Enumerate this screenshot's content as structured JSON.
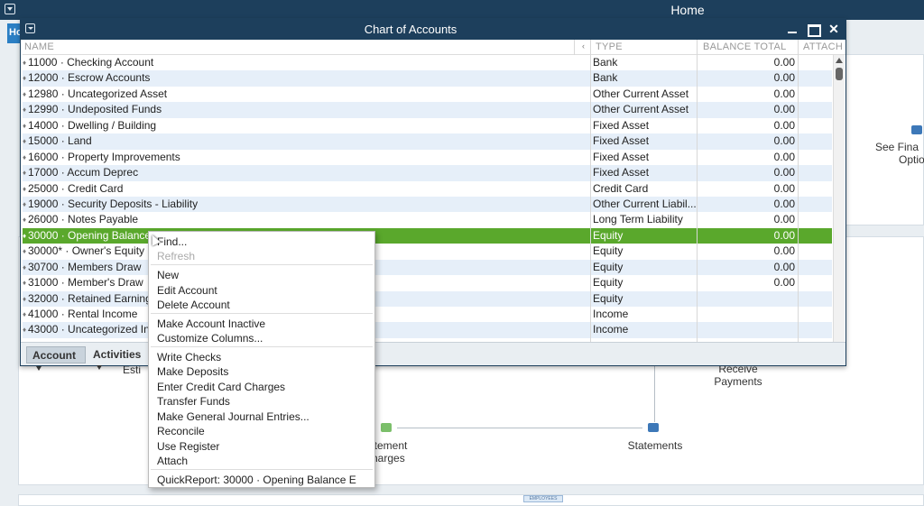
{
  "app": {
    "title": "Home",
    "tab_label": "Ho"
  },
  "background": {
    "see_financing_line1": "See Fina",
    "see_financing_line2": "Optio",
    "receive_payments_line1": "Receive",
    "receive_payments_line2": "Payments",
    "statement_charges_line1": "atement",
    "statement_charges_line2": "harges",
    "statements": "Statements",
    "estimates": "Esti",
    "employees_badge": "EMPLOYEES"
  },
  "window": {
    "title": "Chart of Accounts",
    "columns": {
      "name": "NAME",
      "type": "TYPE",
      "balance": "BALANCE TOTAL",
      "attach": "ATTACH",
      "sort_marker": "‹"
    },
    "rows": [
      {
        "name": "11000 · Checking Account",
        "type": "Bank",
        "balance": "0.00"
      },
      {
        "name": "12000 · Escrow Accounts",
        "type": "Bank",
        "balance": "0.00"
      },
      {
        "name": "12980 · Uncategorized Asset",
        "type": "Other Current Asset",
        "balance": "0.00"
      },
      {
        "name": "12990 · Undeposited Funds",
        "type": "Other Current Asset",
        "balance": "0.00"
      },
      {
        "name": "14000 · Dwelling / Building",
        "type": "Fixed Asset",
        "balance": "0.00"
      },
      {
        "name": "15000 · Land",
        "type": "Fixed Asset",
        "balance": "0.00"
      },
      {
        "name": "16000 · Property Improvements",
        "type": "Fixed Asset",
        "balance": "0.00"
      },
      {
        "name": "17000 · Accum Deprec",
        "type": "Fixed Asset",
        "balance": "0.00"
      },
      {
        "name": "25000 · Credit Card",
        "type": "Credit Card",
        "balance": "0.00"
      },
      {
        "name": "19000 · Security Deposits - Liability",
        "type": "Other Current Liabil...",
        "balance": "0.00"
      },
      {
        "name": "26000 · Notes Payable",
        "type": "Long Term Liability",
        "balance": "0.00"
      },
      {
        "name": "30000 · Opening Balance",
        "type": "Equity",
        "balance": "0.00"
      },
      {
        "name": "30000* · Owner's Equity",
        "type": "Equity",
        "balance": "0.00"
      },
      {
        "name": "30700 · Members Draw",
        "type": "Equity",
        "balance": "0.00"
      },
      {
        "name": "31000 · Member's Draw",
        "type": "Equity",
        "balance": "0.00"
      },
      {
        "name": "32000 · Retained Earning",
        "type": "Equity",
        "balance": ""
      },
      {
        "name": "41000 · Rental Income",
        "type": "Income",
        "balance": ""
      },
      {
        "name": "43000 · Uncategorized In",
        "type": "Income",
        "balance": ""
      }
    ],
    "footer": {
      "account_label": "Account",
      "activities_label": "Activities"
    }
  },
  "context_menu": {
    "items": [
      {
        "label": "Find...",
        "disabled": false
      },
      {
        "label": "Refresh",
        "disabled": true
      },
      {
        "label": "New",
        "disabled": false
      },
      {
        "label": "Edit Account",
        "disabled": false
      },
      {
        "label": "Delete Account",
        "disabled": false
      },
      {
        "label": "Make Account Inactive",
        "disabled": false
      },
      {
        "label": "Customize Columns...",
        "disabled": false
      },
      {
        "label": "Write Checks",
        "disabled": false
      },
      {
        "label": "Make Deposits",
        "disabled": false
      },
      {
        "label": "Enter Credit Card Charges",
        "disabled": false
      },
      {
        "label": "Transfer Funds",
        "disabled": false
      },
      {
        "label": "Make General Journal Entries...",
        "disabled": false
      },
      {
        "label": "Reconcile",
        "disabled": false
      },
      {
        "label": "Use Register",
        "disabled": false
      },
      {
        "label": "Attach",
        "disabled": false
      },
      {
        "label": "QuickReport: 30000 · Opening Balance E",
        "disabled": false
      }
    ]
  },
  "colors": {
    "title_bar": "#1d3f5c",
    "selected_row": "#5aa82c",
    "alt_row": "#e6eff9"
  }
}
